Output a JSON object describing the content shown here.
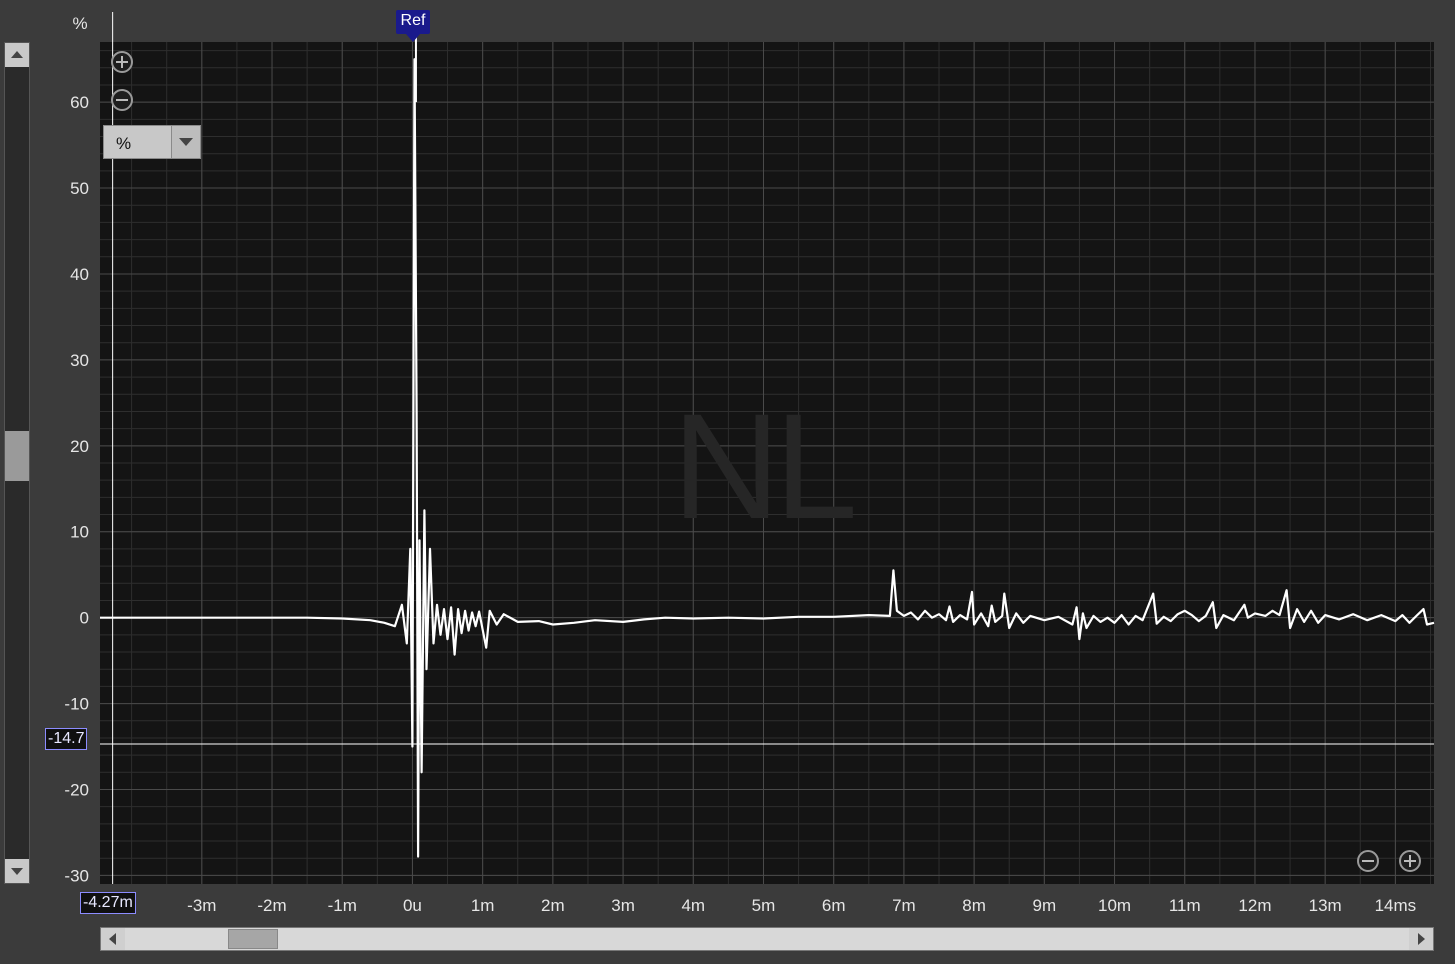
{
  "chart_data": {
    "type": "line",
    "ylabel": "%",
    "xlabel": "",
    "ylim": [
      -31,
      67
    ],
    "xlim": [
      -4.45,
      14.55
    ],
    "x_unit": "ms",
    "y_ticks": [
      60,
      50,
      40,
      30,
      20,
      10,
      0,
      -10,
      -20,
      -30
    ],
    "y_tick_labels": [
      "60",
      "50",
      "40",
      "30",
      "20",
      "10",
      "0",
      "-10",
      "-20",
      "-30"
    ],
    "x_ticks": [
      -3,
      -2,
      -1,
      0,
      1,
      2,
      3,
      4,
      5,
      6,
      7,
      8,
      9,
      10,
      11,
      12,
      13,
      14
    ],
    "x_tick_labels": [
      "-3m",
      "-2m",
      "-1m",
      "0u",
      "1m",
      "2m",
      "3m",
      "4m",
      "5m",
      "6m",
      "7m",
      "8m",
      "9m",
      "10m",
      "11m",
      "12m",
      "13m",
      "14ms"
    ],
    "grid": true,
    "series": [
      {
        "color": "#ffffff",
        "points": [
          [
            -4.45,
            0.0
          ],
          [
            -3.5,
            0.0
          ],
          [
            -2.5,
            0.0
          ],
          [
            -1.5,
            0.0
          ],
          [
            -1.0,
            -0.1
          ],
          [
            -0.6,
            -0.3
          ],
          [
            -0.4,
            -0.6
          ],
          [
            -0.25,
            -1.0
          ],
          [
            -0.15,
            1.5
          ],
          [
            -0.08,
            -3.0
          ],
          [
            -0.03,
            8.0
          ],
          [
            0.0,
            -15.0
          ],
          [
            0.03,
            65.0
          ],
          [
            0.06,
            24.0
          ],
          [
            0.08,
            -27.8
          ],
          [
            0.1,
            9.0
          ],
          [
            0.13,
            -18.0
          ],
          [
            0.17,
            12.5
          ],
          [
            0.2,
            -6.0
          ],
          [
            0.25,
            8.0
          ],
          [
            0.3,
            -3.0
          ],
          [
            0.35,
            1.5
          ],
          [
            0.4,
            -2.0
          ],
          [
            0.45,
            1.0
          ],
          [
            0.5,
            -2.5
          ],
          [
            0.55,
            1.2
          ],
          [
            0.6,
            -4.3
          ],
          [
            0.65,
            1.0
          ],
          [
            0.7,
            -1.8
          ],
          [
            0.75,
            0.8
          ],
          [
            0.8,
            -1.5
          ],
          [
            0.85,
            0.6
          ],
          [
            0.9,
            -1.0
          ],
          [
            0.95,
            0.7
          ],
          [
            1.05,
            -3.5
          ],
          [
            1.1,
            0.8
          ],
          [
            1.2,
            -0.8
          ],
          [
            1.3,
            0.4
          ],
          [
            1.5,
            -0.5
          ],
          [
            1.8,
            -0.4
          ],
          [
            2.0,
            -0.8
          ],
          [
            2.3,
            -0.6
          ],
          [
            2.6,
            -0.3
          ],
          [
            3.0,
            -0.5
          ],
          [
            3.3,
            -0.2
          ],
          [
            3.6,
            0.0
          ],
          [
            4.0,
            -0.1
          ],
          [
            4.5,
            0.0
          ],
          [
            5.0,
            -0.1
          ],
          [
            5.5,
            0.1
          ],
          [
            6.0,
            0.1
          ],
          [
            6.5,
            0.3
          ],
          [
            6.8,
            0.2
          ],
          [
            6.85,
            5.5
          ],
          [
            6.9,
            0.8
          ],
          [
            7.0,
            0.2
          ],
          [
            7.1,
            0.6
          ],
          [
            7.2,
            -0.2
          ],
          [
            7.3,
            0.8
          ],
          [
            7.4,
            0.0
          ],
          [
            7.5,
            0.4
          ],
          [
            7.6,
            -0.3
          ],
          [
            7.65,
            1.3
          ],
          [
            7.7,
            -0.5
          ],
          [
            7.8,
            0.3
          ],
          [
            7.9,
            -0.2
          ],
          [
            7.97,
            3.0
          ],
          [
            8.0,
            -0.8
          ],
          [
            8.1,
            0.5
          ],
          [
            8.2,
            -1.0
          ],
          [
            8.25,
            1.4
          ],
          [
            8.3,
            -0.5
          ],
          [
            8.4,
            0.2
          ],
          [
            8.43,
            2.8
          ],
          [
            8.5,
            -1.2
          ],
          [
            8.6,
            0.5
          ],
          [
            8.7,
            -0.6
          ],
          [
            8.8,
            0.2
          ],
          [
            9.0,
            -0.3
          ],
          [
            9.2,
            0.1
          ],
          [
            9.4,
            -0.8
          ],
          [
            9.46,
            1.2
          ],
          [
            9.5,
            -2.5
          ],
          [
            9.55,
            0.5
          ],
          [
            9.6,
            -1.2
          ],
          [
            9.7,
            0.2
          ],
          [
            9.8,
            -0.5
          ],
          [
            9.9,
            0.0
          ],
          [
            10.0,
            -0.6
          ],
          [
            10.1,
            0.3
          ],
          [
            10.2,
            -0.8
          ],
          [
            10.3,
            0.2
          ],
          [
            10.4,
            -0.3
          ],
          [
            10.55,
            2.8
          ],
          [
            10.6,
            -0.7
          ],
          [
            10.7,
            0.1
          ],
          [
            10.8,
            -0.4
          ],
          [
            10.9,
            0.4
          ],
          [
            11.0,
            0.8
          ],
          [
            11.1,
            0.3
          ],
          [
            11.2,
            -0.4
          ],
          [
            11.3,
            0.2
          ],
          [
            11.4,
            1.8
          ],
          [
            11.45,
            -1.2
          ],
          [
            11.55,
            0.3
          ],
          [
            11.7,
            -0.3
          ],
          [
            11.85,
            1.5
          ],
          [
            11.9,
            0.0
          ],
          [
            12.0,
            0.5
          ],
          [
            12.15,
            0.2
          ],
          [
            12.25,
            0.8
          ],
          [
            12.35,
            0.3
          ],
          [
            12.45,
            3.2
          ],
          [
            12.5,
            -1.2
          ],
          [
            12.6,
            1.0
          ],
          [
            12.7,
            -0.5
          ],
          [
            12.8,
            0.8
          ],
          [
            12.9,
            -0.6
          ],
          [
            13.0,
            0.3
          ],
          [
            13.2,
            -0.2
          ],
          [
            13.4,
            0.4
          ],
          [
            13.6,
            -0.3
          ],
          [
            13.8,
            0.3
          ],
          [
            14.0,
            -0.4
          ],
          [
            14.1,
            0.3
          ],
          [
            14.2,
            -0.6
          ],
          [
            14.3,
            0.2
          ],
          [
            14.4,
            1.0
          ],
          [
            14.45,
            -0.8
          ],
          [
            14.55,
            -0.6
          ]
        ]
      }
    ]
  },
  "ref_marker": {
    "label": "Ref",
    "x": 0.05
  },
  "cursor": {
    "y_value": -14.7,
    "y_label": "-14.7",
    "x_value": -4.27,
    "x_label": "-4.27m"
  },
  "unit_select": {
    "value": "%"
  },
  "watermark": "NL",
  "colors": {
    "background": "#3b3b3b",
    "plot_bg": "#141414",
    "grid": "#4a4a4a",
    "trace": "#ffffff",
    "ref_flag": "#1a1a8c"
  }
}
